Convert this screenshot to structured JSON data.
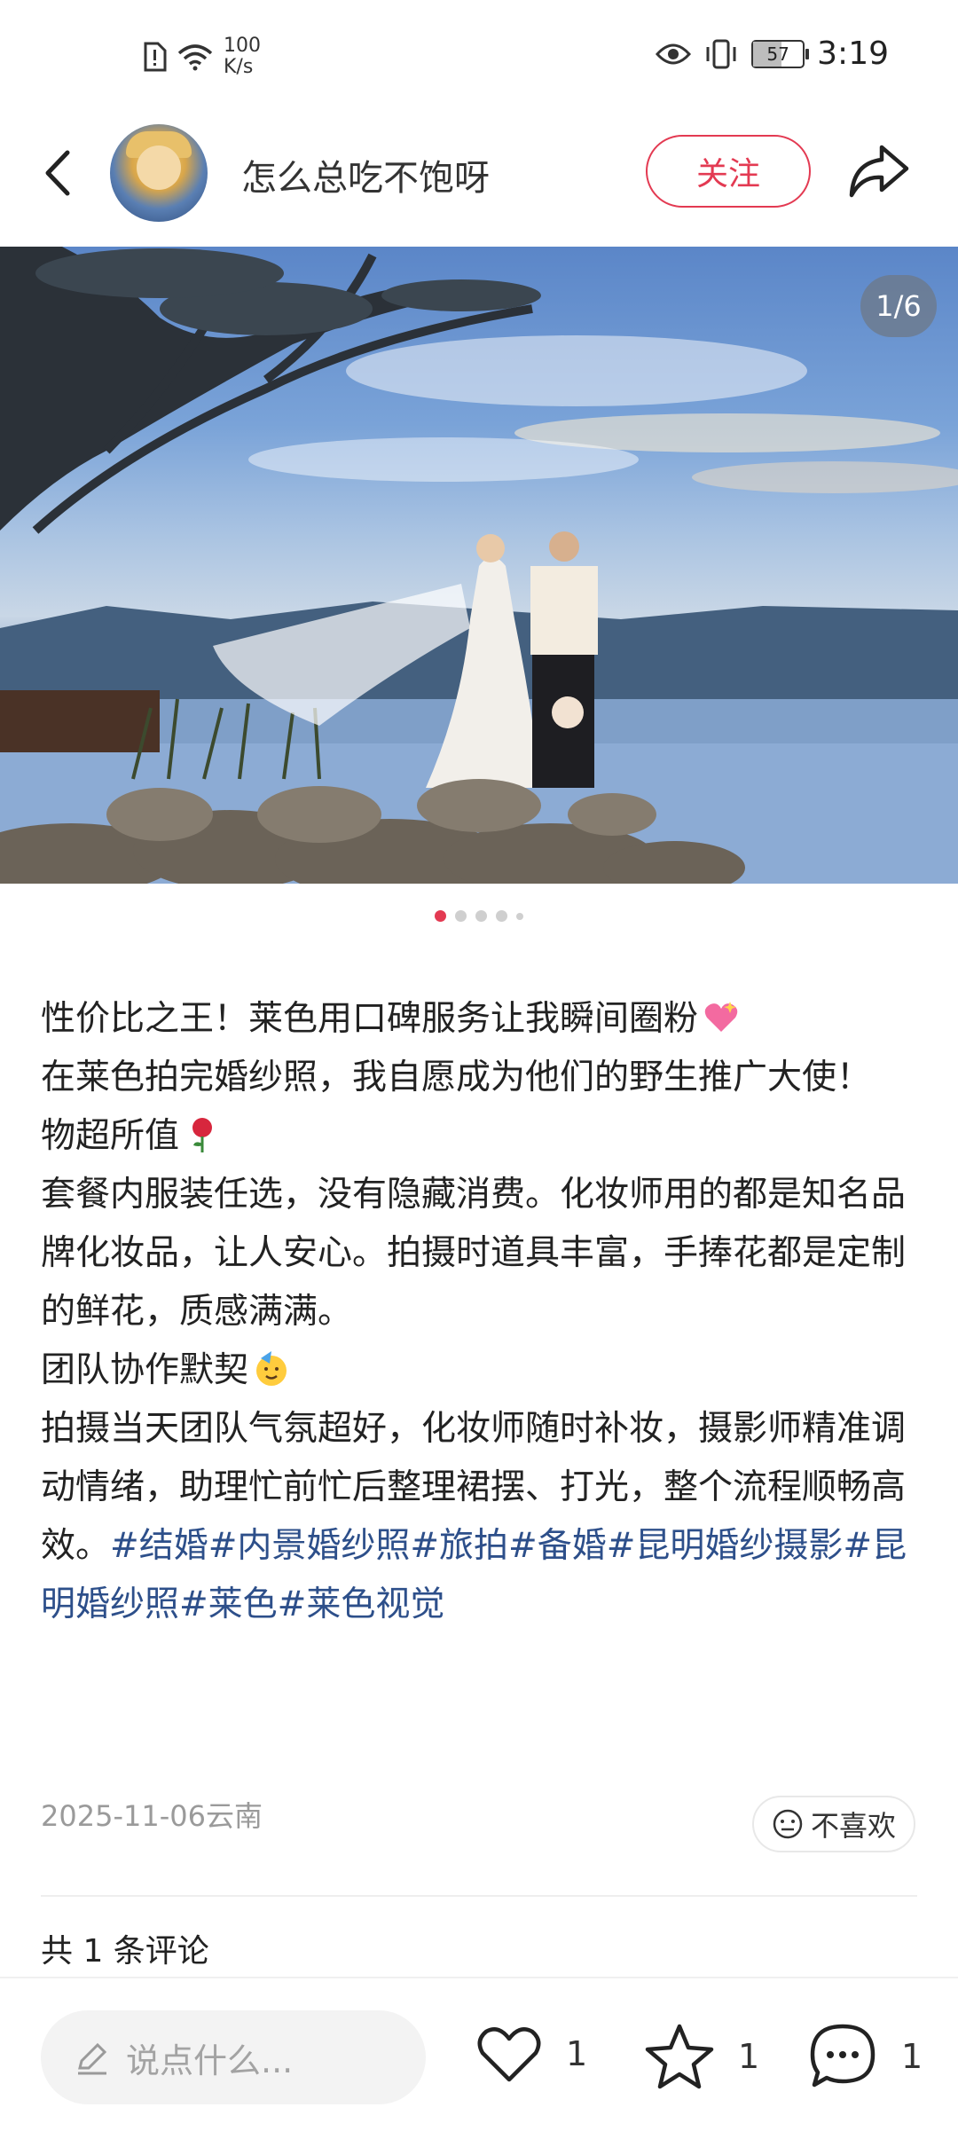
{
  "status_bar": {
    "net_speed_value": "100",
    "net_speed_unit": "K/s",
    "battery": "57",
    "time": "3:19"
  },
  "header": {
    "author_name": "怎么总吃不饱呀",
    "follow_label": "关注"
  },
  "gallery": {
    "counter": "1/6",
    "current_index": 1,
    "total": 6
  },
  "post": {
    "line1": "性价比之王！莱色用口碑服务让我瞬间圈粉",
    "line2": "在莱色拍完婚纱照，我自愿成为他们的野生推广大使！",
    "heading1": "物超所值",
    "para1": "套餐内服装任选，没有隐藏消费。化妆师用的都是知名品牌化妆品，让人安心。拍摄时道具丰富，手捧花都是定制的鲜花，质感满满。",
    "heading2": "团队协作默契",
    "para2": "拍摄当天团队气氛超好，化妆师随时补妆，摄影师精准调动情绪，助理忙前忙后整理裙摆、打光，整个流程顺畅高效。",
    "tags": "#结婚#内景婚纱照#旅拍#备婚#昆明婚纱摄影#昆明婚纱照#莱色#莱色视觉"
  },
  "meta": {
    "date_location": "2025-11-06云南",
    "dislike_label": "不喜欢"
  },
  "comments": {
    "title": "共 1 条评论"
  },
  "bottom_bar": {
    "input_placeholder": "说点什么...",
    "likes": "1",
    "favorites": "1",
    "comments": "1"
  },
  "colors": {
    "accent": "#e33a52",
    "tag": "#2d4f8a"
  }
}
